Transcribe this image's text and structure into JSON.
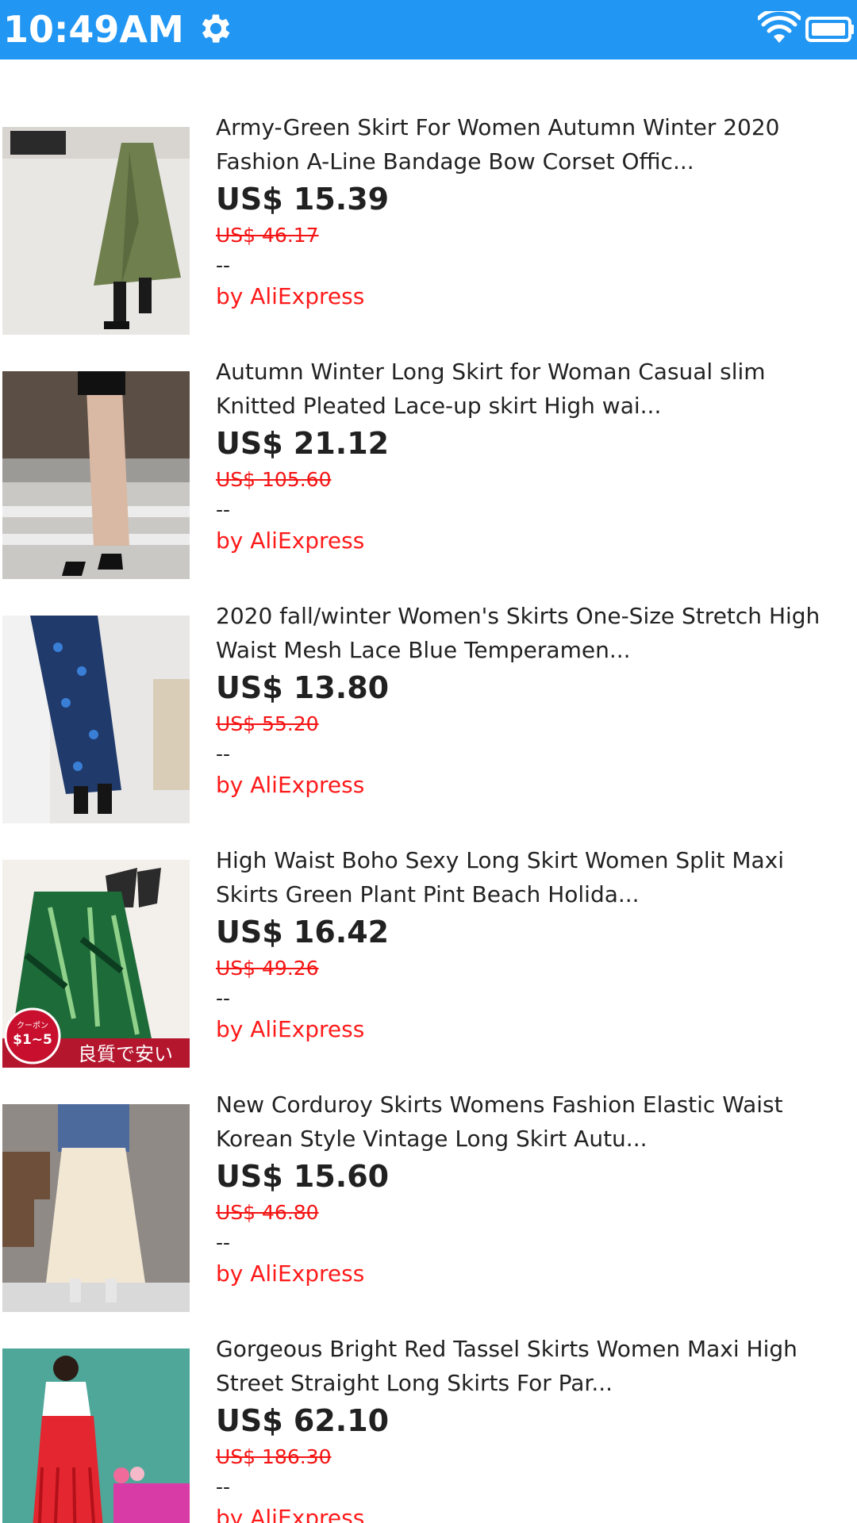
{
  "status_bar": {
    "time": "10:49AM",
    "icons": [
      "gear-icon",
      "wifi-icon",
      "battery-icon"
    ],
    "background": "#2196f3"
  },
  "products": [
    {
      "title": "Army-Green Skirt For Women Autumn Winter 2020\nFashion A-Line Bandage Bow Corset Offic...",
      "price": "US$ 15.39",
      "original_price": "US$ 46.17",
      "rating": "--",
      "seller": "by AliExpress"
    },
    {
      "title": "Autumn Winter Long Skirt for Woman Casual slim\nKnitted Pleated Lace-up skirt High wai...",
      "price": "US$ 21.12",
      "original_price": "US$ 105.60",
      "rating": "--",
      "seller": "by AliExpress"
    },
    {
      "title": "2020 fall/winter Women's Skirts One-Size Stretch High\nWaist Mesh Lace Blue Temperamen...",
      "price": "US$ 13.80",
      "original_price": "US$ 55.20",
      "rating": "--",
      "seller": "by AliExpress"
    },
    {
      "title": "High Waist Boho Sexy Long Skirt Women Split Maxi\nSkirts Green Plant Pint Beach Holida...",
      "price": "US$ 16.42",
      "original_price": "US$ 49.26",
      "rating": "--",
      "seller": "by AliExpress",
      "image_badges": {
        "coupon_small": "クーポン",
        "coupon_amount": "$1~5",
        "banner": "良質で安い"
      }
    },
    {
      "title": "New Corduroy Skirts Womens Fashion Elastic Waist\nKorean Style Vintage Long Skirt Autu...",
      "price": "US$ 15.60",
      "original_price": "US$ 46.80",
      "rating": "--",
      "seller": "by AliExpress"
    },
    {
      "title": "Gorgeous Bright Red Tassel Skirts Women Maxi High\nStreet Straight Long Skirts For Par...",
      "price": "US$ 62.10",
      "original_price": "US$ 186.30",
      "rating": "--",
      "seller": "by AliExpress"
    }
  ]
}
